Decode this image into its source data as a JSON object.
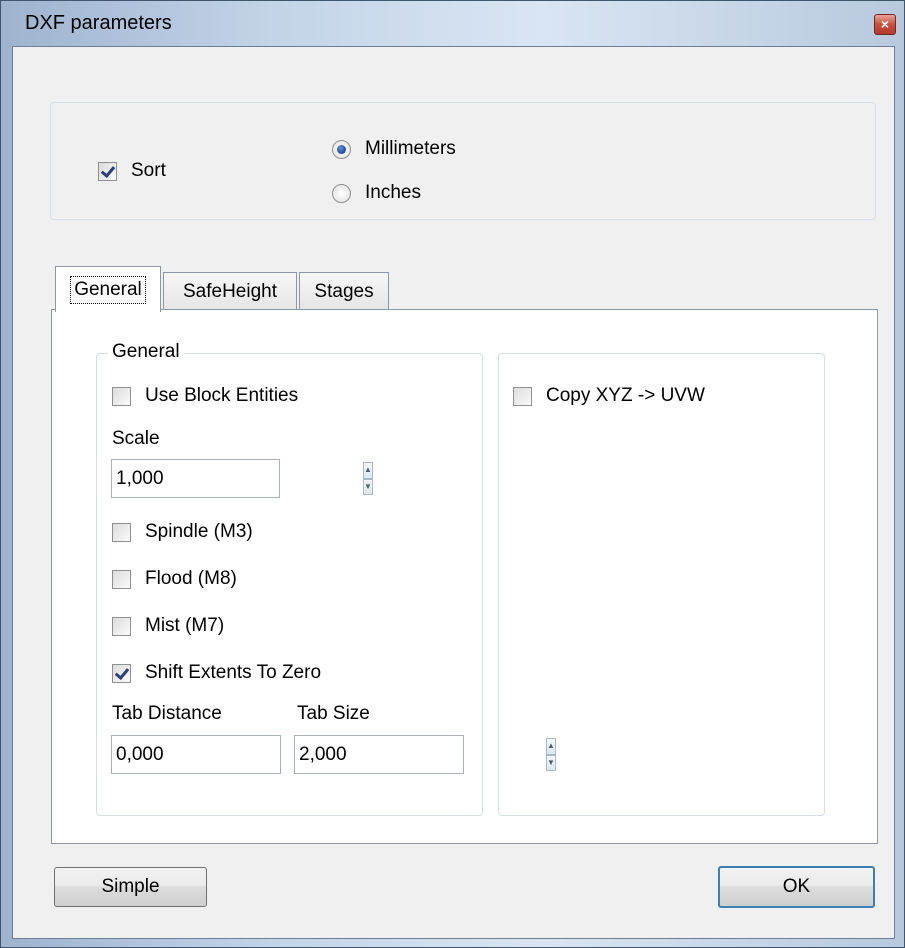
{
  "window": {
    "title": "DXF parameters",
    "close_glyph": "×"
  },
  "top_group": {
    "sort": {
      "label": "Sort",
      "checked": true
    },
    "units": [
      {
        "label": "Millimeters",
        "selected": true
      },
      {
        "label": "Inches",
        "selected": false
      }
    ]
  },
  "tabs": [
    {
      "label": "General",
      "active": true
    },
    {
      "label": "SafeHeight",
      "active": false
    },
    {
      "label": "Stages",
      "active": false
    }
  ],
  "general_tab": {
    "group_title": "General",
    "use_block_entities": {
      "label": "Use Block Entities",
      "checked": false
    },
    "scale": {
      "label": "Scale",
      "value": "1,000"
    },
    "spindle": {
      "label": "Spindle (M3)",
      "checked": false
    },
    "flood": {
      "label": "Flood (M8)",
      "checked": false
    },
    "mist": {
      "label": "Mist (M7)",
      "checked": false
    },
    "shift_extents": {
      "label": "Shift Extents To Zero",
      "checked": true
    },
    "tab_distance": {
      "label": "Tab Distance",
      "value": "0,000"
    },
    "tab_size": {
      "label": "Tab Size",
      "value": "2,000"
    },
    "copy_xyz": {
      "label": "Copy XYZ -> UVW",
      "checked": false
    }
  },
  "buttons": {
    "simple": "Simple",
    "ok": "OK"
  },
  "icons": {
    "spin_up": "▲",
    "spin_down": "▼"
  }
}
